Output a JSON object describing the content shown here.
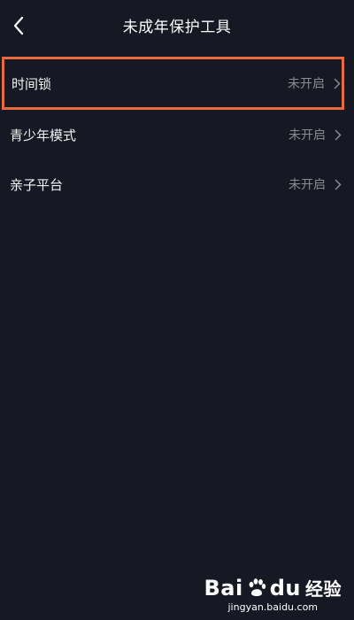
{
  "header": {
    "title": "未成年保护工具",
    "back_icon": "chevron-left-icon"
  },
  "menu": {
    "items": [
      {
        "label": "时间锁",
        "status": "未开启",
        "highlighted": true
      },
      {
        "label": "青少年模式",
        "status": "未开启",
        "highlighted": false
      },
      {
        "label": "亲子平台",
        "status": "未开启",
        "highlighted": false
      }
    ]
  },
  "watermark": {
    "brand_a": "Bai",
    "brand_b": "du",
    "suffix": "经验",
    "url": "jingyan.baidu.com"
  },
  "colors": {
    "background": "#161823",
    "highlight_border": "#e8693e",
    "status_text": "#8a8b91"
  }
}
